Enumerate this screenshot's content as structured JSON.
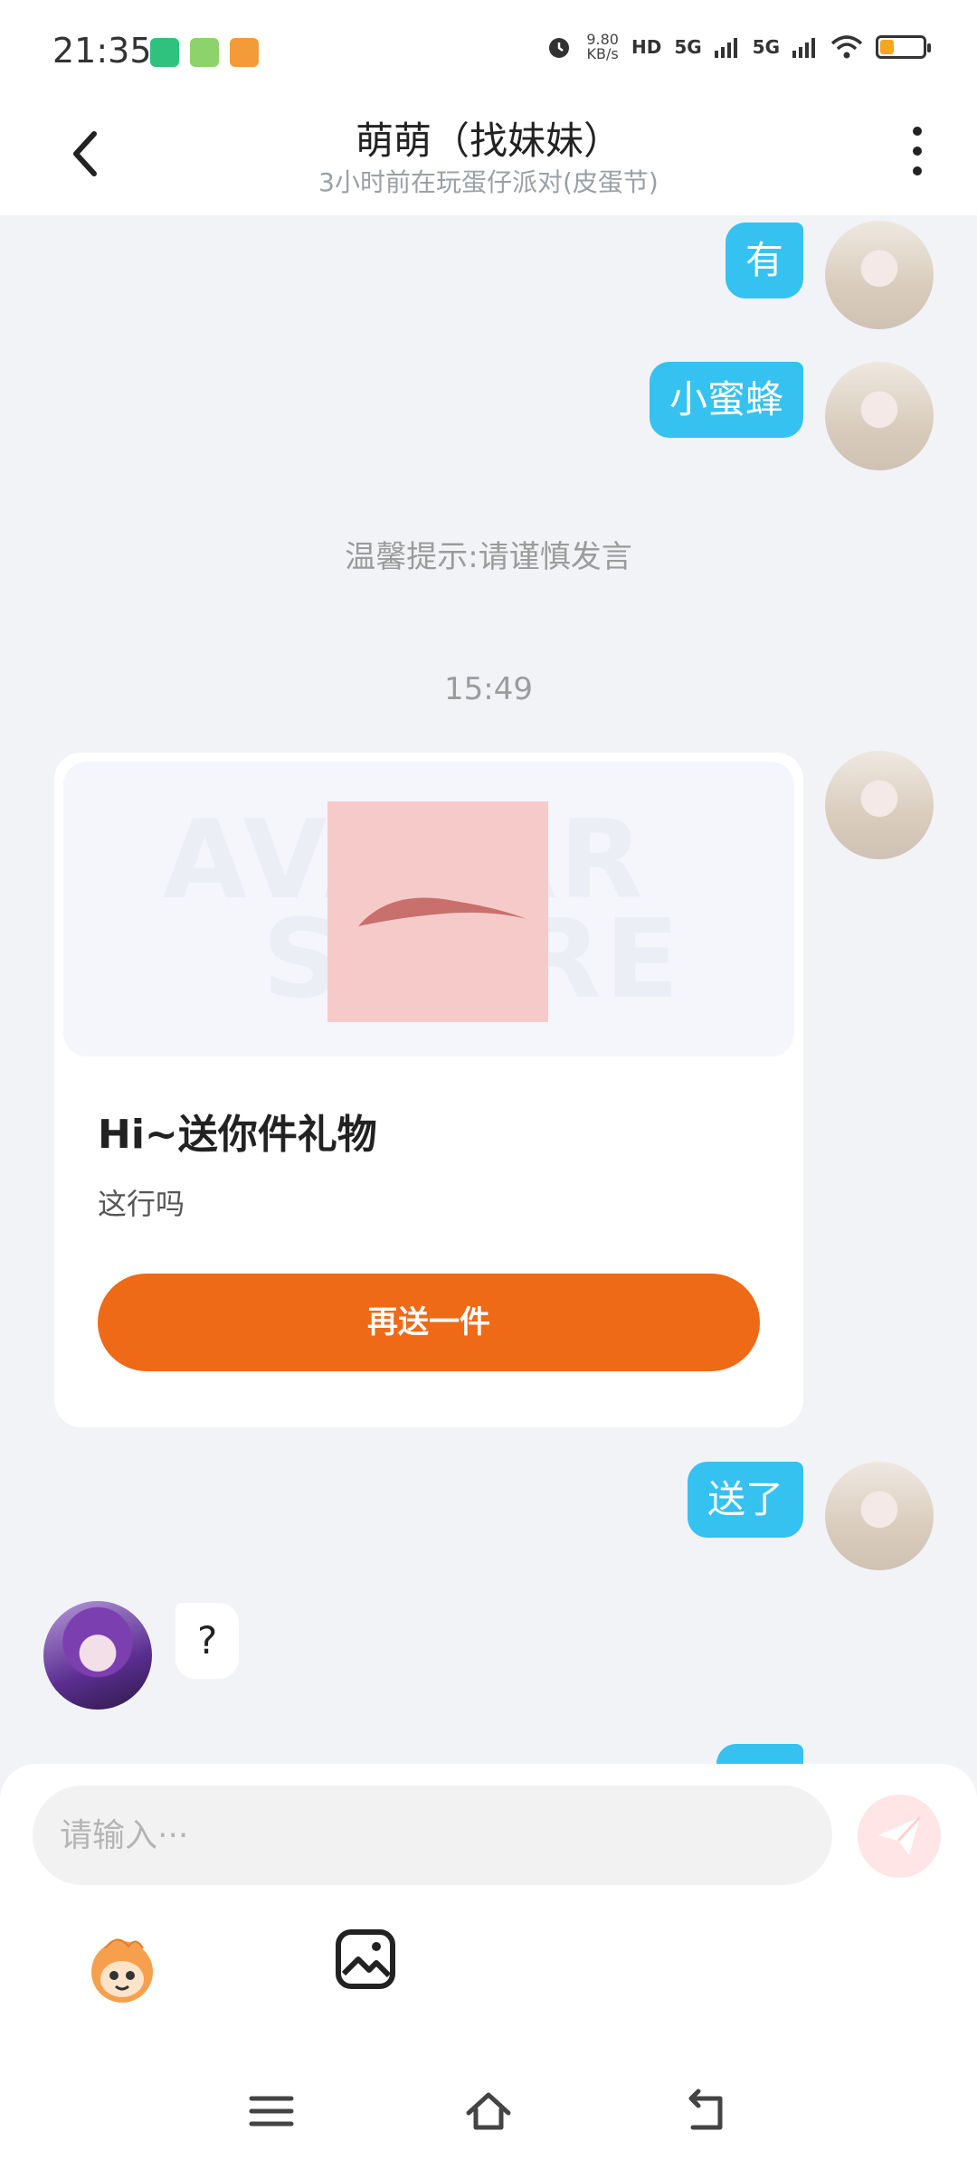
{
  "status_bar": {
    "time": "21:35",
    "net_speed_value": "9.80",
    "net_speed_unit": "KB/s",
    "hd_label": "HD",
    "signal1": "5G",
    "signal2": "5G"
  },
  "header": {
    "title": "萌萌（找妹妹）",
    "subtitle": "3小时前在玩蛋仔派对(皮蛋节)"
  },
  "messages": {
    "m1": "有",
    "m2": "小蜜蜂",
    "tip": "温馨提示:请谨慎发言",
    "time": "15:49",
    "m3": "送了",
    "m4": "?"
  },
  "gift_card": {
    "watermark_top": "AVATAR",
    "watermark_bottom": "STORE",
    "title": "Hi~送你件礼物",
    "desc": "这行吗",
    "button": "再送一件"
  },
  "composer": {
    "placeholder": "请输入···"
  },
  "colors": {
    "bubble_me": "#35c2f0",
    "gift_button": "#ee6a17",
    "background": "#f2f3f7"
  }
}
